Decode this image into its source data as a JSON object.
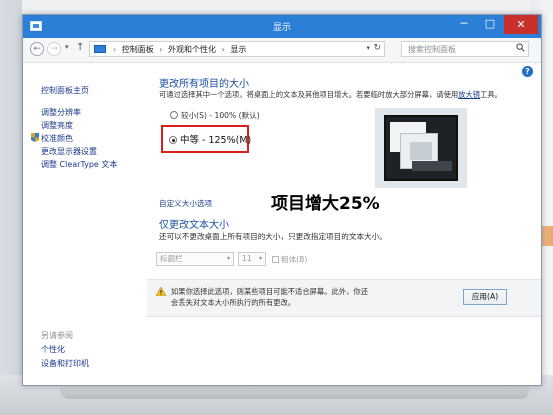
{
  "window": {
    "title": "显示"
  },
  "nav": {
    "back_glyph": "←",
    "forward_glyph": "→",
    "dropdown_glyph": "▾",
    "up_glyph": "↑",
    "refresh_glyph": "↻",
    "breadcrumbs": [
      "控制面板",
      "外观和个性化",
      "显示"
    ],
    "breadcrumb_separator": "›",
    "search_placeholder": "搜索控制面板"
  },
  "controls": {
    "minimize": "─",
    "maximize": "□",
    "close": "✕"
  },
  "sidebar": {
    "home_link": "控制面板主页",
    "items": [
      "调整分辨率",
      "调整亮度",
      "校准颜色",
      "更改显示器设置",
      "调整 ClearType 文本"
    ],
    "see_also_label": "另请参阅",
    "see_also_items": [
      "个性化",
      "设备和打印机"
    ]
  },
  "main": {
    "help_glyph": "?",
    "heading_size": "更改所有项目的大小",
    "desc_prefix": "可通过选择其中一个选项，将桌面上的文本及其他项目增大。若要临时放大部分屏幕，请使用",
    "desc_link": "放大镜",
    "desc_suffix": "工具。",
    "option_small": "较小(S) - 100% (默认)",
    "option_medium": "中等 - 125%(M)",
    "selected_option": "中等 - 125%(M)",
    "custom_link": "自定义大小选项",
    "overlay_caption": "项目增大25%",
    "heading_text": "仅更改文本大小",
    "desc_text": "还可以不更改桌面上所有项目的大小，只更改指定项目的文本大小。",
    "item_select_value": "标题栏",
    "size_select_value": "11",
    "bold_label": "粗体(B)",
    "warning_text": "如果你选择此选项，则某些项目可能不适合屏幕。此外，你还会丢失对文本大小所执行的所有更改。",
    "apply_button": "应用(A)"
  },
  "colors": {
    "titlebar": "#2b7fd6",
    "close_button": "#c7302b",
    "heading": "#1a4fa0",
    "link": "#1a3a8a",
    "highlight_box": "#d9201b"
  },
  "icons": {
    "app": "display-window-icon",
    "sidebar_shield": "shield-icon",
    "address": "control-panel-icon",
    "search": "search-icon",
    "help": "help-icon",
    "warning": "warning-icon"
  }
}
